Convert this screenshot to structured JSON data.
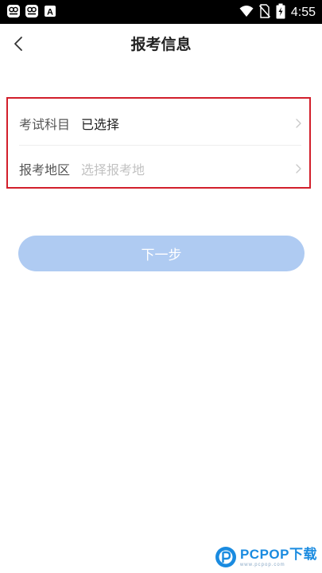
{
  "status_bar": {
    "time": "4:55",
    "left_icons": [
      "notification-app-icon",
      "notification-app-icon",
      "a-notification-icon"
    ],
    "right_icons": [
      "wifi-icon",
      "no-sim-icon",
      "battery-charging-icon"
    ],
    "a_glyph": "A"
  },
  "nav": {
    "back_icon": "chevron-left-icon",
    "title": "报考信息"
  },
  "form": {
    "highlight_color": "#d21f2b",
    "rows": [
      {
        "label": "考试科目",
        "value": "已选择",
        "is_placeholder": false
      },
      {
        "label": "报考地区",
        "value": "选择报考地",
        "is_placeholder": true
      }
    ],
    "chevron_icon": "chevron-right-icon"
  },
  "next_button": {
    "label": "下一步",
    "color": "#afcbf2"
  },
  "watermark": {
    "main": "PCPOP下载",
    "sub": "www.pcpop.com",
    "color": "#1a8be0"
  }
}
